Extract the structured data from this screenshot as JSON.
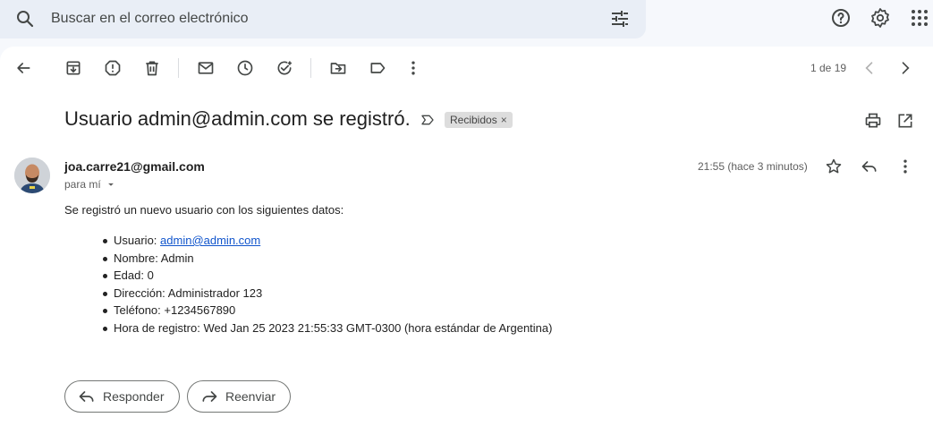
{
  "search": {
    "placeholder": "Buscar en el correo electrónico",
    "icons": [
      "search-icon",
      "tune-icon"
    ]
  },
  "top_right_icons": [
    "help-icon",
    "settings-icon",
    "apps-grid-icon"
  ],
  "toolbar": {
    "icons": [
      "back-arrow-icon",
      "archive-icon",
      "report-spam-icon",
      "delete-icon",
      "mark-unread-icon",
      "snooze-icon",
      "add-task-icon",
      "move-to-icon",
      "label-icon",
      "more-vert-icon"
    ],
    "pager_text": "1 de 19",
    "pager_icons": [
      "chevron-left-icon",
      "chevron-right-icon"
    ]
  },
  "message": {
    "subject": "Usuario admin@admin.com se registró.",
    "label_chip": "Recibidos",
    "sender": "joa.carre21@gmail.com",
    "to_text": "para mí",
    "time": "21:55 (hace 3 minutos)",
    "intro": "Se registró un nuevo usuario con los siguientes datos:",
    "fields": [
      {
        "label": "Usuario: ",
        "value": "admin@admin.com"
      },
      {
        "label": "Nombre: ",
        "value": "Admin"
      },
      {
        "label": "Edad: ",
        "value": "0"
      },
      {
        "label": "Dirección: ",
        "value": "Administrador 123"
      },
      {
        "label": "Teléfono: ",
        "value": "+1234567890"
      },
      {
        "label": "Hora de registro: ",
        "value": "Wed Jan 25 2023 21:55:33 GMT-0300 (hora estándar de Argentina)"
      }
    ]
  },
  "actions": {
    "reply": "Responder",
    "forward": "Reenviar"
  },
  "colors": {
    "page_bg": "#f6f8fc",
    "search_bg": "#e9eef6",
    "link": "#1155cc",
    "chip_bg": "#dddddd"
  }
}
